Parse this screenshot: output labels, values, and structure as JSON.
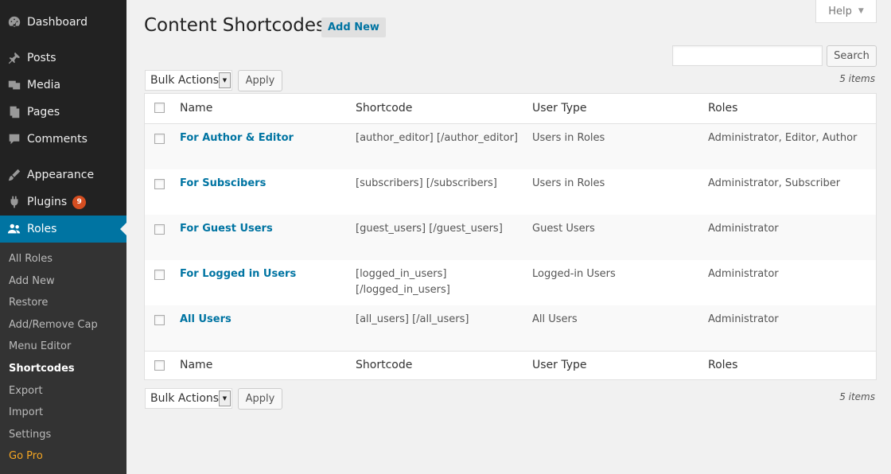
{
  "sidebar": {
    "menu": [
      {
        "label": "Dashboard",
        "icon": "dashboard-icon"
      },
      {
        "label": "Posts",
        "icon": "pin-icon"
      },
      {
        "label": "Media",
        "icon": "media-icon"
      },
      {
        "label": "Pages",
        "icon": "pages-icon"
      },
      {
        "label": "Comments",
        "icon": "comment-icon"
      },
      {
        "label": "Appearance",
        "icon": "brush-icon"
      },
      {
        "label": "Plugins",
        "icon": "plugin-icon",
        "badge": "9"
      },
      {
        "label": "Roles",
        "icon": "users-icon"
      }
    ],
    "submenu": [
      "All Roles",
      "Add New",
      "Restore",
      "Add/Remove Cap",
      "Menu Editor",
      "Shortcodes",
      "Export",
      "Import",
      "Settings",
      "Go Pro"
    ]
  },
  "header": {
    "help": "Help",
    "title": "Content Shortcodes",
    "add_new": "Add New"
  },
  "search": {
    "button": "Search",
    "placeholder": ""
  },
  "bulk": {
    "label": "Bulk Actions",
    "apply": "Apply",
    "count": "5 items"
  },
  "table": {
    "columns": [
      "Name",
      "Shortcode",
      "User Type",
      "Roles"
    ],
    "rows": [
      {
        "name": "For Author & Editor",
        "shortcode": "[author_editor] [/author_editor]",
        "user_type": "Users in Roles",
        "roles": "Administrator, Editor, Author"
      },
      {
        "name": "For Subscibers",
        "shortcode": "[subscribers] [/subscribers]",
        "user_type": "Users in Roles",
        "roles": "Administrator, Subscriber"
      },
      {
        "name": "For Guest Users",
        "shortcode": "[guest_users] [/guest_users]",
        "user_type": "Guest Users",
        "roles": "Administrator"
      },
      {
        "name": "For Logged in Users",
        "shortcode": "[logged_in_users]",
        "shortcode2": "[/logged_in_users]",
        "user_type": "Logged-in Users",
        "roles": "Administrator"
      },
      {
        "name": "All Users",
        "shortcode": "[all_users] [/all_users]",
        "user_type": "All Users",
        "roles": "Administrator"
      }
    ]
  },
  "colors": {
    "sidebar_bg": "#222222",
    "active": "#0074a2",
    "link": "#0074a2",
    "badge": "#d54e21",
    "gopro": "#f5a623"
  }
}
